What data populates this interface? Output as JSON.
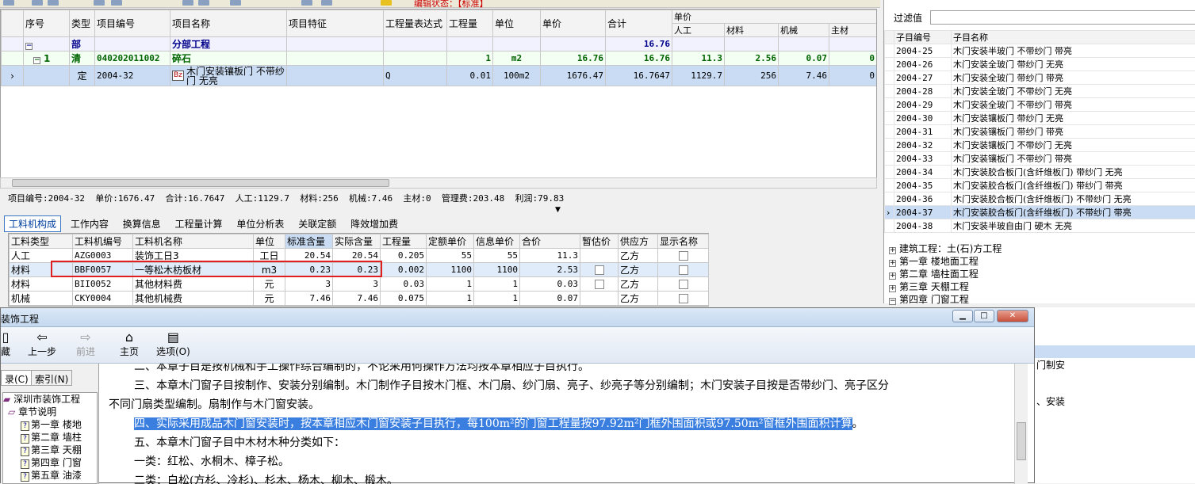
{
  "top_status": "编辑状态：【标准】",
  "grid": {
    "headers": {
      "seq": "序号",
      "type": "类型",
      "code": "项目编号",
      "name": "项目名称",
      "feature": "项目特征",
      "expr": "工程量表达式",
      "qty": "工程量",
      "unit": "单位",
      "price": "单价",
      "total": "合计",
      "unit_price": "单价",
      "labor": "人工",
      "material": "材料",
      "machine": "机械",
      "main_mat": "主材",
      "extra": "人"
    },
    "rows": [
      {
        "seq": "",
        "type": "部",
        "code": "",
        "name": "分部工程",
        "feature": "",
        "expr": "",
        "qty": "",
        "unit": "",
        "price": "",
        "total": "16.76",
        "labor": "",
        "material": "",
        "machine": "",
        "main_mat": ""
      },
      {
        "seq": "1",
        "type": "清",
        "code": "040202011002",
        "name": "碎石",
        "feature": "",
        "expr": "",
        "qty": "1",
        "unit": "m2",
        "price": "16.76",
        "total": "16.76",
        "labor": "11.3",
        "material": "2.56",
        "machine": "0.07",
        "main_mat": "0"
      },
      {
        "seq": "",
        "type": "定",
        "code": "2004-32",
        "name": "木门安装镶板门 不带纱门 无亮",
        "badge": "Bz",
        "feature": "",
        "expr": "Q",
        "qty": "0.01",
        "unit": "100m2",
        "price": "1676.47",
        "total": "16.7647",
        "labor": "1129.7",
        "material": "256",
        "machine": "7.46",
        "main_mat": "0"
      }
    ]
  },
  "info_line": "项目编号:2004-32  单价:1676.47  合计:16.7647  人工:1129.7  材料:256  机械:7.46  主材:0  管理费:203.48  利润:79.83",
  "tabs": [
    "工料机构成",
    "工作内容",
    "换算信息",
    "工程量计算",
    "单位分析表",
    "关联定额",
    "降效增加费"
  ],
  "sub": {
    "headers": {
      "type": "工料类型",
      "code": "工料机编号",
      "name": "工料机名称",
      "unit": "单位",
      "std": "标准含量",
      "act": "实际含量",
      "qty": "工程量",
      "quota_price": "定额单价",
      "info_price": "信息单价",
      "total": "合价",
      "temp": "暂估价",
      "supplier": "供应方",
      "show": "显示名称"
    },
    "rows": [
      {
        "type": "人工",
        "code": "AZG0003",
        "name": "装饰工日3",
        "unit": "工日",
        "std": "20.54",
        "act": "20.54",
        "qty": "0.205",
        "quota_price": "55",
        "info_price": "55",
        "total": "11.3",
        "supplier": "乙方"
      },
      {
        "type": "材料",
        "code": "BBF0057",
        "name": "一等松木枋板材",
        "unit": "m3",
        "std": "0.23",
        "act": "0.23",
        "qty": "0.002",
        "quota_price": "1100",
        "info_price": "1100",
        "total": "2.53",
        "supplier": "乙方"
      },
      {
        "type": "材料",
        "code": "BII0052",
        "name": "其他材料费",
        "unit": "元",
        "std": "3",
        "act": "3",
        "qty": "0.03",
        "quota_price": "1",
        "info_price": "1",
        "total": "0.03",
        "supplier": "乙方"
      },
      {
        "type": "机械",
        "code": "CKY0004",
        "name": "其他机械费",
        "unit": "元",
        "std": "7.46",
        "act": "7.46",
        "qty": "0.075",
        "quota_price": "1",
        "info_price": "1",
        "total": "0.07",
        "supplier": "乙方"
      }
    ]
  },
  "right": {
    "filter_label": "过滤值",
    "col_code": "子目编号",
    "col_name": "子目名称",
    "items": [
      {
        "code": "2004-25",
        "name": "木门安装半玻门 不带纱门 带亮"
      },
      {
        "code": "2004-26",
        "name": "木门安装全玻门 带纱门 无亮"
      },
      {
        "code": "2004-27",
        "name": "木门安装全玻门 带纱门 带亮"
      },
      {
        "code": "2004-28",
        "name": "木门安装全玻门 不带纱门 无亮"
      },
      {
        "code": "2004-29",
        "name": "木门安装全玻门 不带纱门 带亮"
      },
      {
        "code": "2004-30",
        "name": "木门安装镶板门 带纱门 无亮"
      },
      {
        "code": "2004-31",
        "name": "木门安装镶板门 带纱门 带亮"
      },
      {
        "code": "2004-32",
        "name": "木门安装镶板门 不带纱门 无亮"
      },
      {
        "code": "2004-33",
        "name": "木门安装镶板门 不带纱门 带亮"
      },
      {
        "code": "2004-34",
        "name": "木门安装胶合板门(含纤维板门) 带纱门 无亮"
      },
      {
        "code": "2004-35",
        "name": "木门安装胶合板门(含纤维板门) 带纱门 带亮"
      },
      {
        "code": "2004-36",
        "name": "木门安装胶合板门(含纤维板门) 不带纱门 无亮"
      },
      {
        "code": "2004-37",
        "name": "木门安装胶合板门(含纤维板门) 不带纱门 带亮"
      },
      {
        "code": "2004-38",
        "name": "木门安装半玻自由门 硬木 无亮"
      }
    ],
    "tree": [
      "建筑工程：土(石)方工程",
      "第一章 楼地面工程",
      "第二章 墙柱面工程",
      "第三章 天棚工程",
      "第四章 门窗工程"
    ]
  },
  "help": {
    "title": "装饰工程",
    "btn_hide": "藏",
    "btn_back": "上一步",
    "btn_forward": "前进",
    "btn_home": "主页",
    "btn_options": "选项(O)",
    "tab_contents": "录(C)",
    "tab_index": "索引(N)",
    "tree": [
      "深圳市装饰工程",
      "章节说明",
      "第一章 楼地",
      "第二章 墙柱",
      "第三章 天棚",
      "第四章 门窗",
      "第五章 油漆"
    ],
    "p2": "二、本章子目是按机械和手工操作综合编制的，不论采用何操作方法均按本章相应子目执行。",
    "p3a": "三、本章木门窗子目按制作、安装分别编制。木门制作子目按木门框、木门扇、纱门扇、亮子、纱亮子等分别编制；木门安装子目按是否带纱门、亮子区分",
    "p3b": "不同门扇类型编制。扇制作与木门窗安装。",
    "p4": "四、实际采用成品木门窗安装时，按本章相应木门窗安装子目执行，每100m²的门窗工程量按97.92m²门框外围面积或97.50m²窗框外围面积计算",
    "p4end": "。",
    "p5": "五、本章木门窗子目中木材木种分类如下：",
    "p6": "一类：红松、水桐木、樟子松。",
    "p7": "二类：白松(方杉、冷杉)、杉木、杨木、柳木、椴木。"
  },
  "ghost": {
    "t1": "门制安",
    "t2": "、安装"
  }
}
